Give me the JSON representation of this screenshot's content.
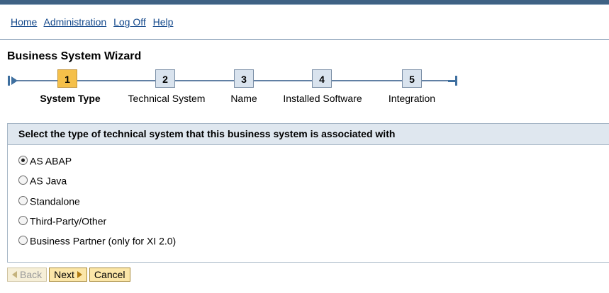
{
  "nav": {
    "home": "Home",
    "administration": "Administration",
    "logoff": "Log Off",
    "help": "Help"
  },
  "wizard": {
    "title": "Business System Wizard",
    "steps": [
      {
        "number": "1",
        "label": "System Type",
        "active": true
      },
      {
        "number": "2",
        "label": "Technical System",
        "active": false
      },
      {
        "number": "3",
        "label": "Name",
        "active": false
      },
      {
        "number": "4",
        "label": "Installed Software",
        "active": false
      },
      {
        "number": "5",
        "label": "Integration",
        "active": false
      }
    ]
  },
  "panel": {
    "header": "Select the type of technical system that this business system is associated with",
    "options": [
      {
        "label": "AS ABAP",
        "selected": true
      },
      {
        "label": "AS Java",
        "selected": false
      },
      {
        "label": "Standalone",
        "selected": false
      },
      {
        "label": "Third-Party/Other",
        "selected": false
      },
      {
        "label": "Business Partner (only for XI 2.0)",
        "selected": false
      }
    ]
  },
  "buttons": {
    "back": "Back",
    "next": "Next",
    "cancel": "Cancel"
  },
  "colors": {
    "active_step": "#f5c04a",
    "inactive_step": "#d9e3ee",
    "link": "#13488b",
    "button": "#fbe6a8"
  }
}
